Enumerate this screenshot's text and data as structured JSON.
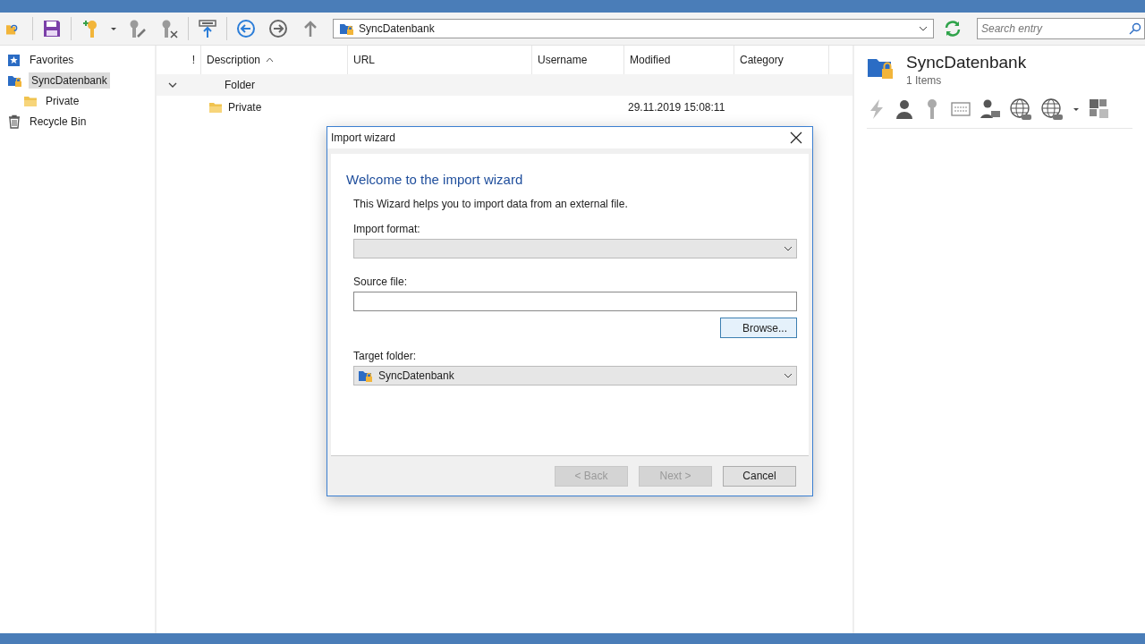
{
  "toolbar": {
    "location": "SyncDatenbank",
    "search": {
      "placeholder": "Search entry"
    }
  },
  "sidebar": {
    "items": [
      {
        "label": "Favorites",
        "kind": "favorites",
        "selected": false
      },
      {
        "label": "SyncDatenbank",
        "kind": "database",
        "selected": true,
        "children": [
          {
            "label": "Private",
            "kind": "folder",
            "selected": false
          }
        ]
      },
      {
        "label": "Recycle Bin",
        "kind": "trash",
        "selected": false
      }
    ]
  },
  "table": {
    "columns": [
      {
        "label": "!",
        "sorted": false
      },
      {
        "label": "Description",
        "sorted": true
      },
      {
        "label": "URL",
        "sorted": false
      },
      {
        "label": "Username",
        "sorted": false
      },
      {
        "label": "Modified",
        "sorted": false
      },
      {
        "label": "Category",
        "sorted": false
      }
    ],
    "groups": [
      {
        "label": "Folder",
        "expanded": true,
        "rows": [
          {
            "description": "Private",
            "modified": "29.11.2019 15:08:11"
          }
        ]
      }
    ]
  },
  "details": {
    "title": "SyncDatenbank",
    "count": "1 Items"
  },
  "dialog": {
    "title": "Import wizard",
    "heading": "Welcome to the import wizard",
    "intro": "This Wizard helps you to import data from an external file.",
    "fields": [
      {
        "kind": "dropdown",
        "label": "Import format:"
      },
      {
        "kind": "file",
        "label": "Source file:",
        "button": "Browse...",
        "focused": true
      },
      {
        "kind": "dropdown",
        "label": "Target folder:",
        "value": "SyncDatenbank"
      }
    ],
    "buttons": [
      {
        "label": "< Back",
        "disabled": true
      },
      {
        "label": "Next >",
        "disabled": true
      },
      {
        "label": "Cancel",
        "disabled": false
      }
    ]
  }
}
